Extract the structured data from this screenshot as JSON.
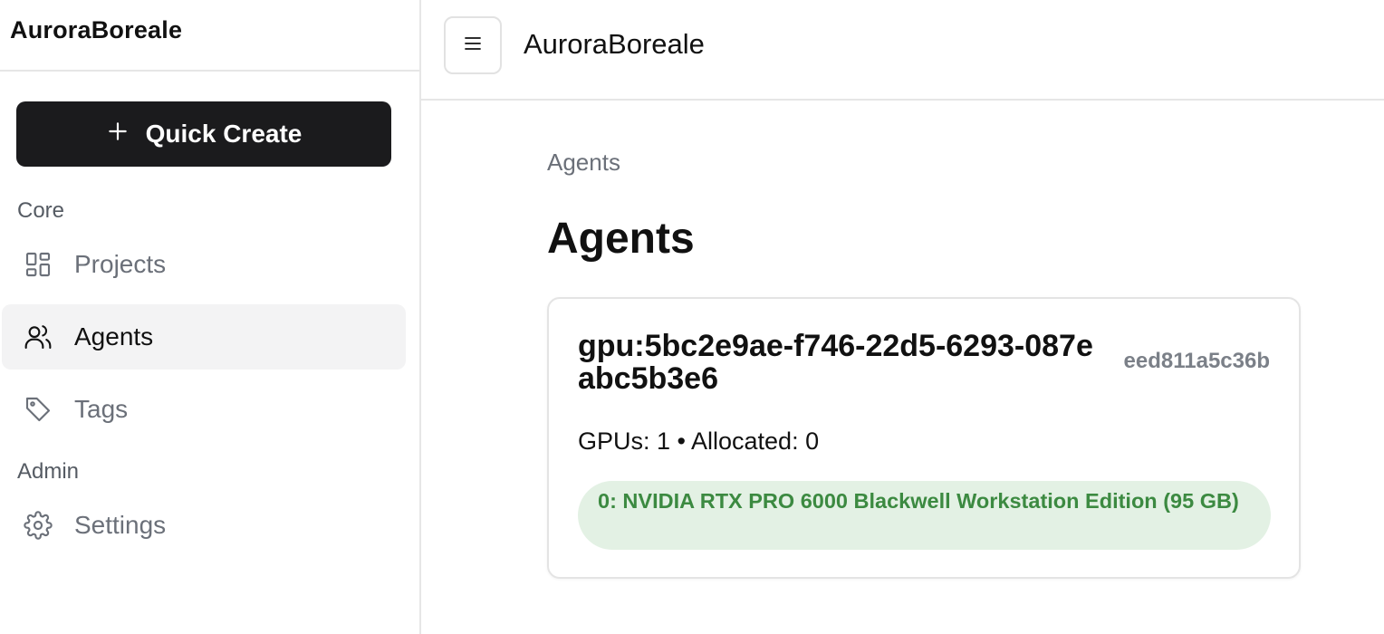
{
  "sidebar": {
    "brand": "AuroraBoreale",
    "quick_create_label": "Quick Create",
    "sections": [
      {
        "label": "Core"
      },
      {
        "label": "Admin"
      }
    ],
    "items": [
      {
        "label": "Projects",
        "icon": "grid-icon",
        "active": false
      },
      {
        "label": "Agents",
        "icon": "users-icon",
        "active": true
      },
      {
        "label": "Tags",
        "icon": "tag-icon",
        "active": false
      },
      {
        "label": "Settings",
        "icon": "gear-icon",
        "active": false
      }
    ]
  },
  "header": {
    "title": "AuroraBoreale",
    "menu_icon": "hamburger-icon"
  },
  "main": {
    "breadcrumb": "Agents",
    "title": "Agents",
    "agents": [
      {
        "name": "gpu:5bc2e9ae-f746-22d5-6293-087eabc5b3e6",
        "id": "eed811a5c36b",
        "stats": "GPUs: 1 • Allocated: 0",
        "gpus": [
          "0: NVIDIA RTX PRO 6000 Blackwell Workstation Edition (95 GB)"
        ]
      }
    ]
  },
  "colors": {
    "primary_button": "#1b1b1d",
    "active_nav_bg": "#f3f3f4",
    "gpu_badge_bg": "#e3f1e4",
    "gpu_badge_text": "#3c8a41"
  }
}
